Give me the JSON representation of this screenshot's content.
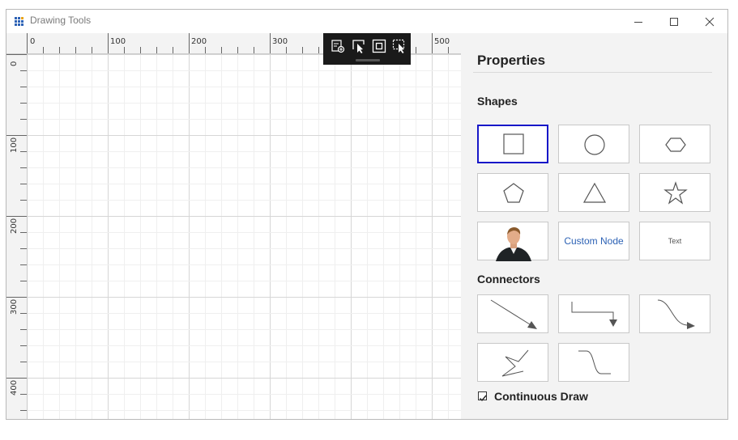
{
  "window": {
    "title": "Drawing Tools",
    "accent_color": "#2d62b5",
    "controls": [
      "minimize-icon",
      "maximize-icon",
      "close-icon"
    ]
  },
  "canvas": {
    "ruler": {
      "horizontal_labels": [
        "0",
        "100",
        "200",
        "300",
        "500"
      ],
      "vertical_labels": [
        "0",
        "100",
        "200",
        "300",
        "400"
      ]
    },
    "toolbar": {
      "background_color": "#1a1a1a",
      "tools": [
        "insert-icon",
        "select-icon",
        "fit-to-page-icon",
        "pointer-select-icon"
      ]
    }
  },
  "panel": {
    "title": "Properties",
    "shapes_header": "Shapes",
    "shapes": [
      {
        "name": "rectangle-icon",
        "selected": true
      },
      {
        "name": "ellipse-icon",
        "selected": false
      },
      {
        "name": "hexagon-icon",
        "selected": false
      },
      {
        "name": "pentagon-icon",
        "selected": false
      },
      {
        "name": "triangle-icon",
        "selected": false
      },
      {
        "name": "star-icon",
        "selected": false
      },
      {
        "name": "person-photo",
        "selected": false
      },
      {
        "name": "custom-node",
        "label": "Custom Node",
        "selected": false
      },
      {
        "name": "text-node",
        "label": "Text",
        "selected": false
      }
    ],
    "selection_color": "#1717c8",
    "connectors_header": "Connectors",
    "connectors": [
      "straight-connector-icon",
      "orthogonal-connector-icon",
      "bezier-connector-icon",
      "freehand-connector-icon",
      "curve-connector-icon"
    ],
    "continuous_draw": {
      "label": "Continuous Draw",
      "checked": true
    }
  }
}
